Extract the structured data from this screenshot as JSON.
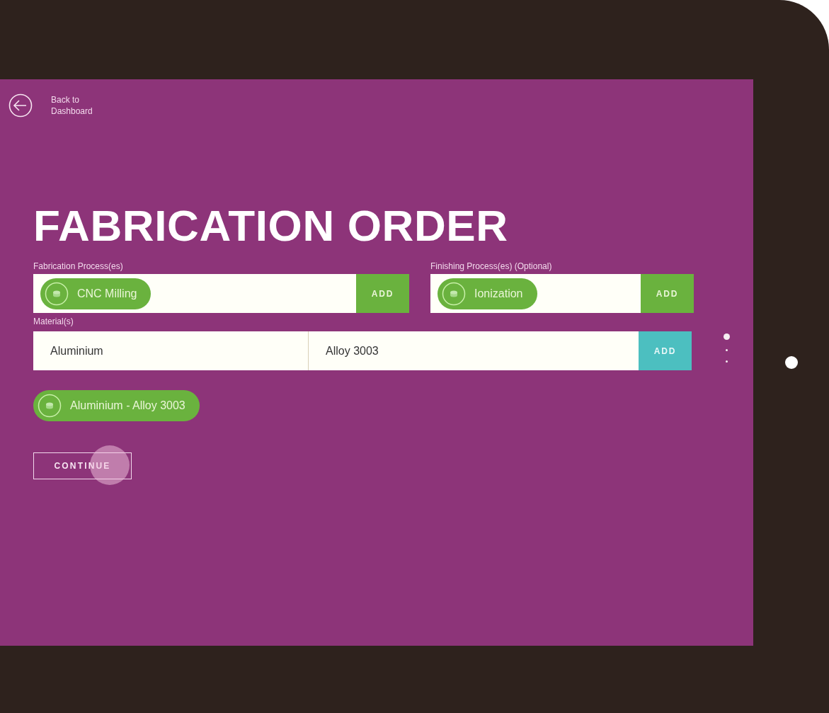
{
  "back_link": {
    "label": "Back to Dashboard"
  },
  "title": "FABRICATION ORDER",
  "fabrication": {
    "label": "Fabrication Process(es)",
    "chips": [
      {
        "label": "CNC Milling"
      }
    ],
    "button": "ADD"
  },
  "finishing": {
    "label": "Finishing Process(es) (Optional)",
    "chips": [
      {
        "label": "Ionization"
      }
    ],
    "button": "ADD"
  },
  "materials": {
    "label": "Material(s)",
    "fields": [
      {
        "value": "Aluminium"
      },
      {
        "value": "Alloy 3003"
      }
    ],
    "button": "ADD",
    "chips": [
      {
        "label": "Aluminium - Alloy 3003"
      }
    ]
  },
  "continue_button": "CONTINUE",
  "pager": [
    {
      "selected": true
    },
    {
      "selected": false
    },
    {
      "selected": false
    }
  ]
}
